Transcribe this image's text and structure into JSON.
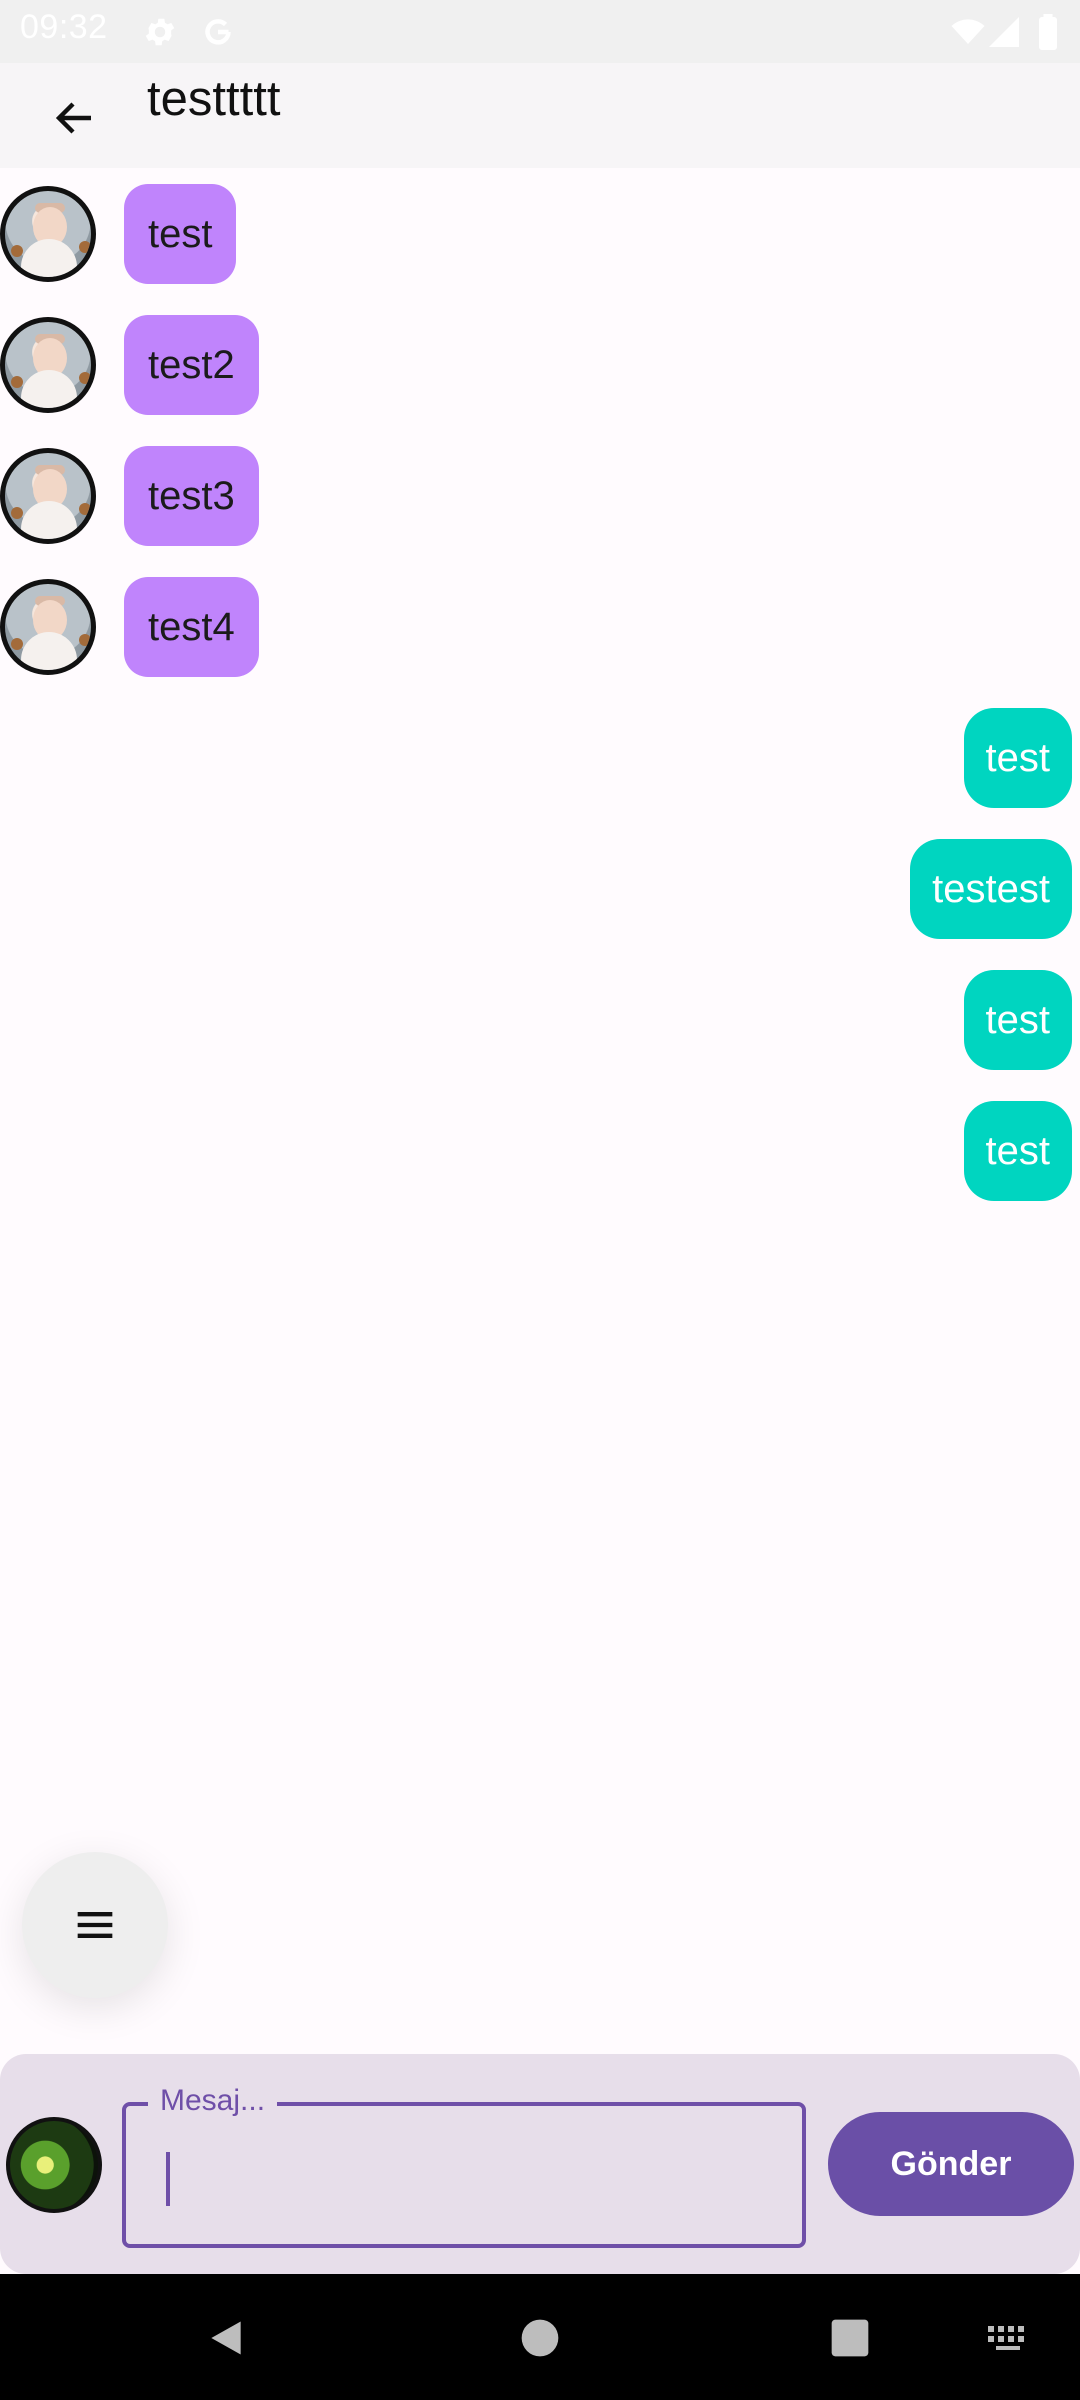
{
  "status_bar": {
    "time": "09:32",
    "icons": [
      "gear-icon",
      "google-icon",
      "wifi-icon",
      "signal-icon",
      "battery-icon"
    ]
  },
  "app_bar": {
    "title": "testtttt",
    "back_icon": "arrow-back-icon"
  },
  "messages": {
    "incoming": [
      {
        "text": "test"
      },
      {
        "text": "test2"
      },
      {
        "text": "test3"
      },
      {
        "text": "test4"
      }
    ],
    "outgoing": [
      {
        "text": "test"
      },
      {
        "text": "testest"
      },
      {
        "text": "test"
      },
      {
        "text": "test"
      }
    ]
  },
  "fab": {
    "icon": "menu-icon"
  },
  "composer": {
    "label": "Mesaj...",
    "value": "",
    "send_label": "Gönder"
  },
  "nav_bar": {
    "icons": [
      "back-triangle-icon",
      "home-circle-icon",
      "recents-square-icon",
      "keyboard-icon"
    ]
  },
  "colors": {
    "incoming_bubble": "#c084fc",
    "outgoing_bubble": "#00d5c0",
    "accent": "#6a4fa7",
    "composer_bg": "#e7deea"
  }
}
